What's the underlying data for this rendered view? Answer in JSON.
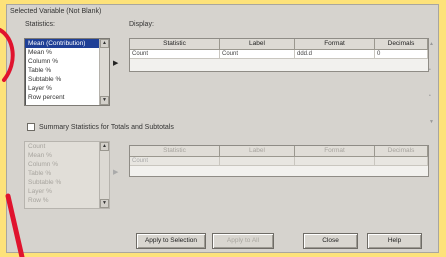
{
  "group": {
    "title": "Selected Variable (Not Blank)"
  },
  "statistics": {
    "label": "Statistics:",
    "items": [
      "Mean (Contribution)",
      "Mean %",
      "Column %",
      "Table %",
      "Subtable %",
      "Layer %",
      "Row percent"
    ],
    "selected_index": 0
  },
  "display": {
    "label": "Display:",
    "columns": [
      "Statistic",
      "Label",
      "Format",
      "Decimals"
    ],
    "rows": [
      [
        "Count",
        "Count",
        "ddd.d",
        "0"
      ]
    ]
  },
  "summary_option": {
    "label": "Summary Statistics for Totals and Subtotals"
  },
  "lower_list": {
    "items": [
      "Count",
      "Mean %",
      "Column %",
      "Table %",
      "Subtable %",
      "Layer %",
      "Row %"
    ]
  },
  "lower_grid": {
    "columns": [
      "Statistic",
      "Label",
      "Format",
      "Decimals"
    ],
    "rows": [
      [
        "Count",
        "",
        "",
        ""
      ]
    ]
  },
  "buttons": {
    "apply": "Apply to Selection",
    "apply_all": "Apply to All",
    "close": "Close",
    "help": "Help"
  }
}
